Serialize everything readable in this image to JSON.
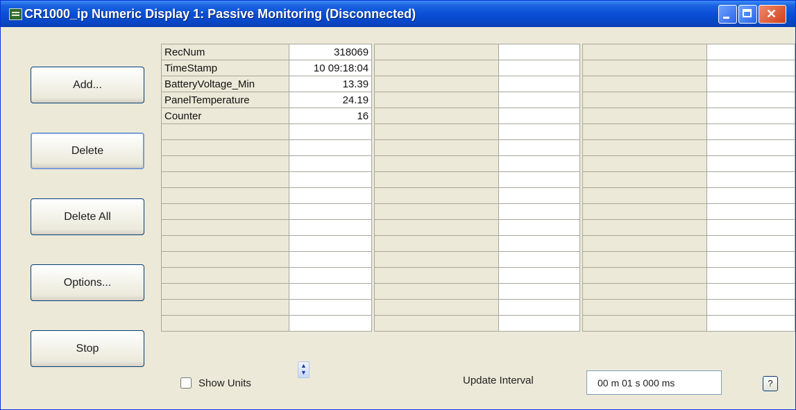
{
  "window": {
    "title": "CR1000_ip Numeric Display 1: Passive Monitoring (Disconnected)"
  },
  "titlebar_icons": [
    "app-icon",
    "minimize-icon",
    "maximize-icon",
    "close-icon"
  ],
  "buttons": {
    "add": "Add...",
    "delete": "Delete",
    "delete_all": "Delete All",
    "options": "Options...",
    "stop": "Stop"
  },
  "grid": {
    "rows": [
      {
        "name": "RecNum",
        "value": "318069"
      },
      {
        "name": "TimeStamp",
        "value": "10 09:18:04"
      },
      {
        "name": "BatteryVoltage_Min",
        "value": "13.39"
      },
      {
        "name": "PanelTemperature",
        "value": "24.19"
      },
      {
        "name": "Counter",
        "value": "16"
      },
      {
        "name": "",
        "value": ""
      },
      {
        "name": "",
        "value": ""
      },
      {
        "name": "",
        "value": ""
      },
      {
        "name": "",
        "value": ""
      },
      {
        "name": "",
        "value": ""
      },
      {
        "name": "",
        "value": ""
      },
      {
        "name": "",
        "value": ""
      },
      {
        "name": "",
        "value": ""
      },
      {
        "name": "",
        "value": ""
      },
      {
        "name": "",
        "value": ""
      },
      {
        "name": "",
        "value": ""
      },
      {
        "name": "",
        "value": ""
      },
      {
        "name": "",
        "value": ""
      }
    ]
  },
  "bottom": {
    "show_units_label": "Show Units",
    "show_units_checked": false,
    "update_interval_label": "Update Interval",
    "update_interval_value": "00 m 01 s 000 ms",
    "help_label": "?"
  },
  "colors": {
    "titlebar": "#0a4fd6",
    "window_face": "#ece9d8",
    "grid_border": "#a7a69c",
    "button_border": "#003c74"
  }
}
